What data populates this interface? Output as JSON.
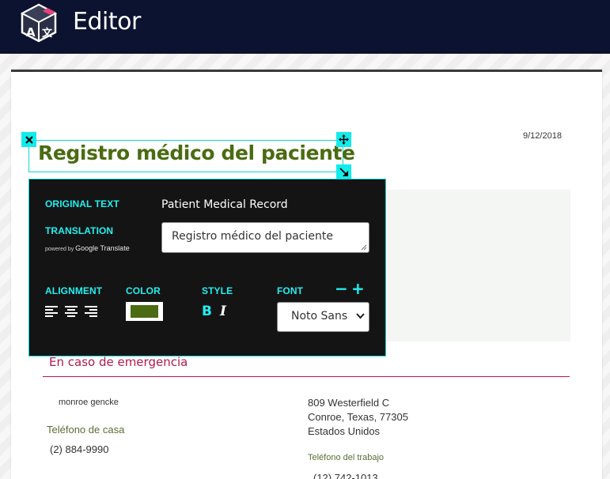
{
  "app": {
    "title": "Editor",
    "logo_icon": "app-logo-icon"
  },
  "document": {
    "date": "9/12/2018",
    "title": "Registro médico del paciente",
    "title_color": "#4a6b12",
    "emergency_section": {
      "heading": "En caso de emergencia",
      "contact_name": "monroe gencke",
      "home_phone_label": "Teléfono de casa",
      "home_phone": "(2) 884-9990",
      "address_line1": "809 Westerfield C",
      "address_line2": "Conroe, Texas, 77305",
      "address_line3": "Estados Unidos",
      "work_phone_label": "Teléfono del trabajo",
      "work_phone": "(12) 742-1013"
    }
  },
  "editor": {
    "original_text_label": "ORIGINAL TEXT",
    "original_text": "Patient Medical Record",
    "translation_label": "TRANSLATION",
    "powered_by": "powered by",
    "powered_by_brand": "Google Translate",
    "translation_value": "Registro médico del paciente",
    "alignment_label": "ALIGNMENT",
    "color_label": "COLOR",
    "selected_color": "#4a6b12",
    "style_label": "STYLE",
    "bold_glyph": "B",
    "italic_glyph": "I",
    "font_label": "FONT",
    "font_decrease": "−",
    "font_increase": "+",
    "font_selected": "Noto Sans"
  },
  "colors": {
    "accent": "#11ecec",
    "topbar": "#0c1330",
    "panel": "#141414",
    "section_heading": "#b3194a"
  }
}
